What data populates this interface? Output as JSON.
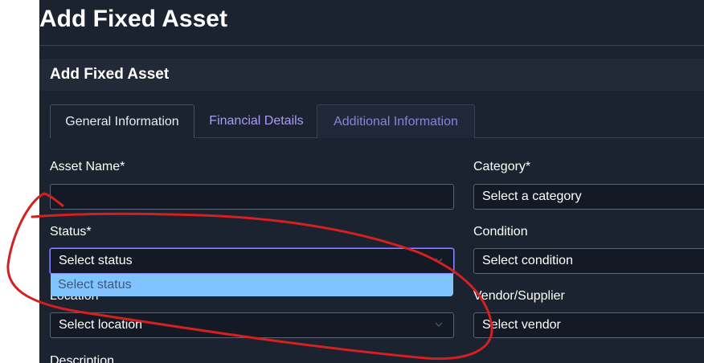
{
  "page": {
    "title": "Add Fixed Asset"
  },
  "card": {
    "title": "Add Fixed Asset"
  },
  "tabs": [
    {
      "label": "General Information",
      "active": true
    },
    {
      "label": "Financial Details",
      "active": false
    },
    {
      "label": "Additional Information",
      "active": false
    }
  ],
  "form": {
    "asset_name": {
      "label": "Asset Name*",
      "value": ""
    },
    "category": {
      "label": "Category*",
      "value": "Select a category"
    },
    "status": {
      "label": "Status*",
      "value": "Select status",
      "options": [
        "Select status"
      ]
    },
    "condition": {
      "label": "Condition",
      "value": "Select condition"
    },
    "location": {
      "label": "Location",
      "value": "Select location"
    },
    "vendor": {
      "label": "Vendor/Supplier",
      "value": "Select vendor"
    },
    "description": {
      "label": "Description"
    }
  },
  "colors": {
    "background": "#1b2230",
    "accent": "#8f86ff",
    "dropdown_highlight": "#80c4ff",
    "annotation_stroke": "#d42020"
  },
  "icons": [
    "chevron-down-icon"
  ]
}
